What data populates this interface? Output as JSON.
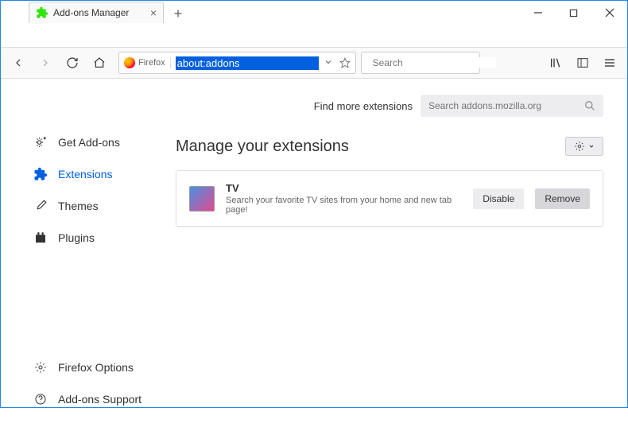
{
  "tab": {
    "title": "Add-ons Manager"
  },
  "urlbar": {
    "identity": "Firefox",
    "value": "about:addons"
  },
  "searchbar": {
    "placeholder": "Search"
  },
  "sidebar": {
    "items": [
      {
        "label": "Get Add-ons"
      },
      {
        "label": "Extensions"
      },
      {
        "label": "Themes"
      },
      {
        "label": "Plugins"
      }
    ],
    "bottom": [
      {
        "label": "Firefox Options"
      },
      {
        "label": "Add-ons Support"
      }
    ]
  },
  "main": {
    "find_label": "Find more extensions",
    "find_placeholder": "Search addons.mozilla.org",
    "heading": "Manage your extensions",
    "ext": {
      "name": "TV",
      "desc": "Search your favorite TV sites from your home and new tab page!",
      "disable": "Disable",
      "remove": "Remove"
    }
  }
}
